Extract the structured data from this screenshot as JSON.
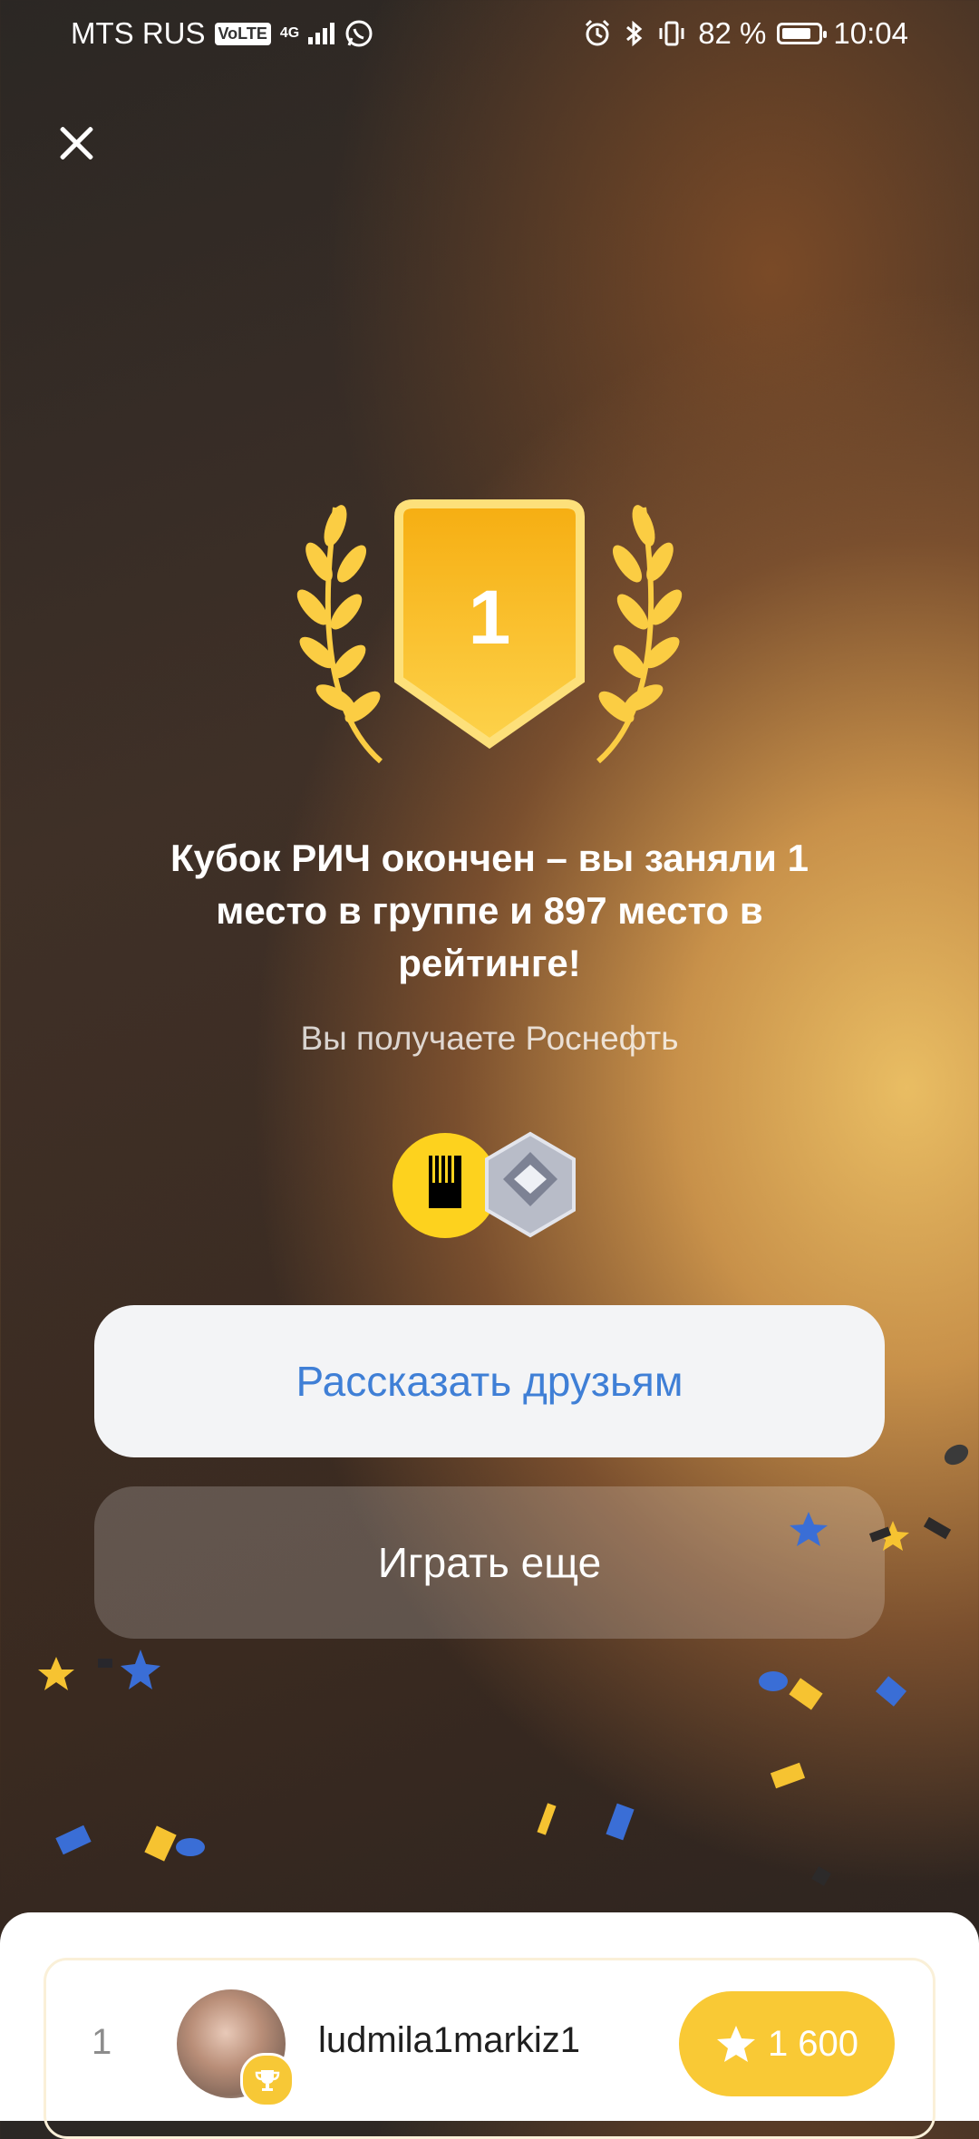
{
  "status_bar": {
    "carrier": "MTS RUS",
    "volte": "VoLTE",
    "network": "4G",
    "battery": "82 %",
    "battery_level": 0.82,
    "time": "10:04"
  },
  "result": {
    "place_number": "1",
    "title": "Кубок РИЧ окончен – вы заняли 1 место в группе и 897 место в рейтинге!",
    "subtitle": "Вы получаете Роснефть"
  },
  "buttons": {
    "share": "Рассказать друзьям",
    "play_again": "Играть еще"
  },
  "leaderboard": [
    {
      "rank": "1",
      "username": "ludmila1markiz1",
      "score": "1 600"
    }
  ],
  "colors": {
    "accent_gold": "#f9c935",
    "link_blue": "#3f7fd6"
  }
}
